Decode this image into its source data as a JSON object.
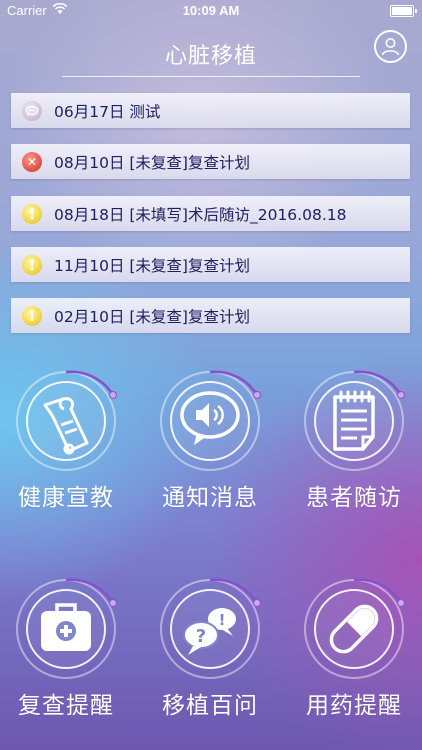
{
  "status_bar": {
    "carrier": "Carrier",
    "time": "10:09 AM"
  },
  "header": {
    "title": "心脏移植"
  },
  "notices": [
    {
      "type": "message",
      "icon": "message-icon",
      "text": "06月17日 测试"
    },
    {
      "type": "error",
      "icon": "error-icon",
      "text": "08月10日 [未复查]复查计划"
    },
    {
      "type": "warning",
      "icon": "warning-icon",
      "text": "08月18日 [未填写]术后随访_2016.08.18"
    },
    {
      "type": "warning",
      "icon": "warning-icon",
      "text": "11月10日 [未复查]复查计划"
    },
    {
      "type": "warning",
      "icon": "warning-icon",
      "text": "02月10日 [未复查]复查计划"
    }
  ],
  "menu": [
    {
      "label": "健康宣教",
      "icon": "scroll-icon"
    },
    {
      "label": "通知消息",
      "icon": "speaker-icon"
    },
    {
      "label": "患者随访",
      "icon": "notepad-icon"
    },
    {
      "label": "复查提醒",
      "icon": "medical-kit-icon"
    },
    {
      "label": "移植百问",
      "icon": "qa-bubbles-icon"
    },
    {
      "label": "用药提醒",
      "icon": "pill-icon"
    }
  ],
  "colors": {
    "notice_text": "#1f2060",
    "warning": "#f1d64a",
    "error": "#e2574b",
    "accent_ring": "#8a4fd0"
  }
}
